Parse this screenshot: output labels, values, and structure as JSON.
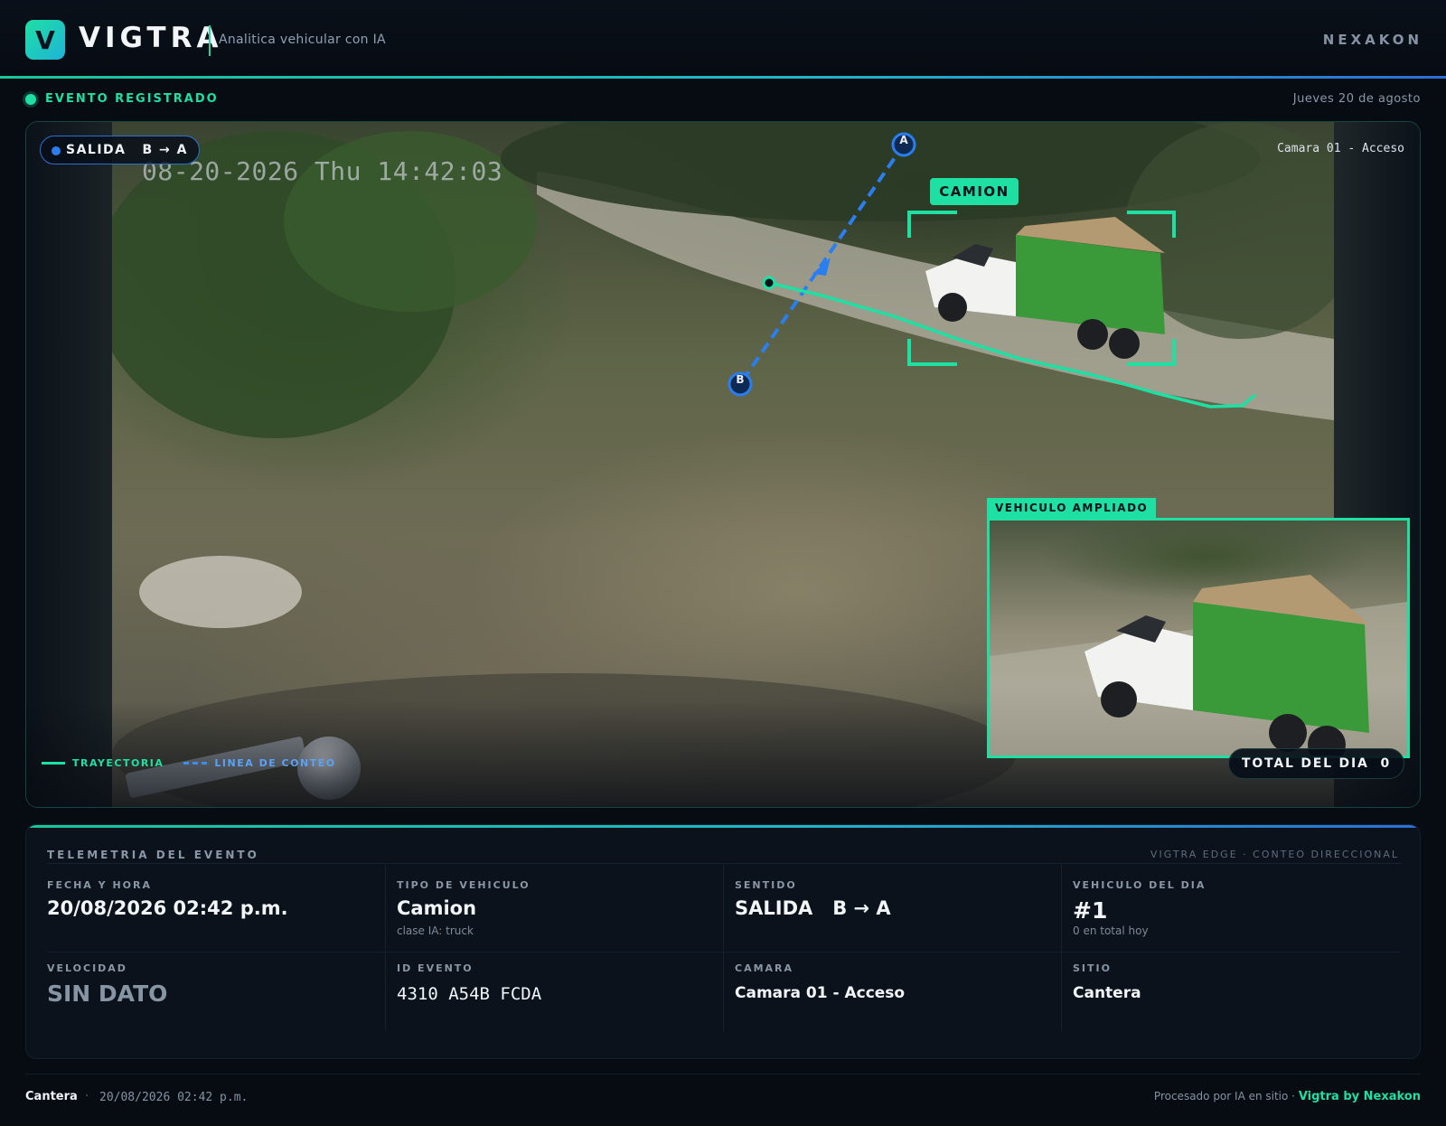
{
  "header": {
    "logo_letter": "V",
    "brand": "VIGTRA",
    "subtitle": "Analitica vehicular con IA",
    "company": "NEXAKON"
  },
  "status": {
    "label": "EVENTO REGISTRADO",
    "date": "Jueves 20 de agosto"
  },
  "video": {
    "timestamp": "08-20-2026 Thu 14:42:03",
    "direction_label": "SALIDA",
    "direction_route": "B → A",
    "camera_label": "Camara 01 - Acceso",
    "point_a": "A",
    "point_b": "B",
    "class_tag": "CAMION",
    "zoom_tag": "VEHICULO AMPLIADO",
    "legend_trajectory": "TRAYECTORIA",
    "legend_count_line": "LINEA DE CONTEO",
    "total_label": "TOTAL DEL DIA",
    "total_value": "0"
  },
  "telemetry": {
    "title": "TELEMETRIA DEL EVENTO",
    "subtitle": "VIGTRA EDGE · CONTEO DIRECCIONAL",
    "fields": {
      "datetime_label": "FECHA Y HORA",
      "datetime_value": "20/08/2026 02:42 p.m.",
      "type_label": "TIPO DE VEHICULO",
      "type_value": "Camion",
      "type_hint": "clase IA: truck",
      "direction_label": "SENTIDO",
      "direction_value": "SALIDA   B → A",
      "daily_label": "VEHICULO DEL DIA",
      "daily_value": "#1",
      "daily_hint": "0 en total hoy",
      "speed_label": "VELOCIDAD",
      "speed_value": "SIN DATO",
      "event_id_label": "ID EVENTO",
      "event_id_value": "4310 A54B FCDA",
      "camera_label": "CAMARA",
      "camera_value": "Camara 01 - Acceso",
      "site_label": "SITIO",
      "site_value": "Cantera"
    }
  },
  "footer": {
    "site": "Cantera",
    "separator": "·",
    "time": "20/08/2026 02:42 p.m.",
    "processed": "Procesado por IA en sitio ·",
    "brand": "Vigtra by Nexakon"
  },
  "colors": {
    "accent": "#1ee0a3",
    "count_line": "#2a7ef0",
    "background": "#070b12"
  }
}
